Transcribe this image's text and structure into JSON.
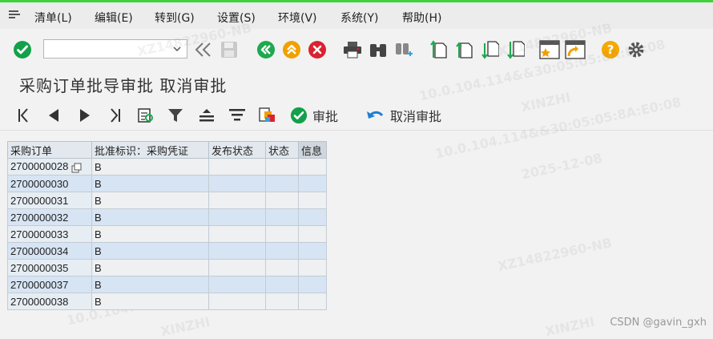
{
  "menu": {
    "items": [
      {
        "label": "清单(L)"
      },
      {
        "label": "编辑(E)"
      },
      {
        "label": "转到(G)"
      },
      {
        "label": "设置(S)"
      },
      {
        "label": "环境(V)"
      },
      {
        "label": "系统(Y)"
      },
      {
        "label": "帮助(H)"
      }
    ]
  },
  "toolbar": {
    "command_value": "",
    "command_placeholder": ""
  },
  "page": {
    "title": "采购订单批导审批 取消审批"
  },
  "app_toolbar": {
    "approve_label": "审批",
    "cancel_approve_label": "取消审批"
  },
  "grid": {
    "columns": [
      "采购订单",
      "批准标识：采购凭证",
      "发布状态",
      "状态",
      "信息"
    ],
    "rows": [
      {
        "po": "2700000028",
        "flag": "B",
        "release": "",
        "status": "",
        "info": ""
      },
      {
        "po": "2700000030",
        "flag": "B",
        "release": "",
        "status": "",
        "info": ""
      },
      {
        "po": "2700000031",
        "flag": "B",
        "release": "",
        "status": "",
        "info": ""
      },
      {
        "po": "2700000032",
        "flag": "B",
        "release": "",
        "status": "",
        "info": ""
      },
      {
        "po": "2700000033",
        "flag": "B",
        "release": "",
        "status": "",
        "info": ""
      },
      {
        "po": "2700000034",
        "flag": "B",
        "release": "",
        "status": "",
        "info": ""
      },
      {
        "po": "2700000035",
        "flag": "B",
        "release": "",
        "status": "",
        "info": ""
      },
      {
        "po": "2700000037",
        "flag": "B",
        "release": "",
        "status": "",
        "info": ""
      },
      {
        "po": "2700000038",
        "flag": "B",
        "release": "",
        "status": "",
        "info": ""
      }
    ]
  },
  "watermarks": [
    "XZ14822960-NB",
    "10.0.104.114&&30:05:05:8A:E0:08",
    "XINZHI",
    "2025-12-08",
    "XZ14822960-NB",
    "10.0.104.114&&30:05:05:8A:E0:08",
    "XINZHI",
    "2025-12-08",
    "XZ14822960-NB",
    "10.0.104.114&&30:05:05:8A:E0:08",
    "XINZHI"
  ],
  "footer": {
    "credit": "CSDN @gavin_gxh"
  },
  "colors": {
    "accent_green": "#3cd23c",
    "ok_green": "#13a04a",
    "back_green": "#1fa84f",
    "up_orange": "#f0a000",
    "cancel_red": "#d9232f",
    "help_orange": "#f5a800",
    "row_alt": "#d7e4f3"
  }
}
